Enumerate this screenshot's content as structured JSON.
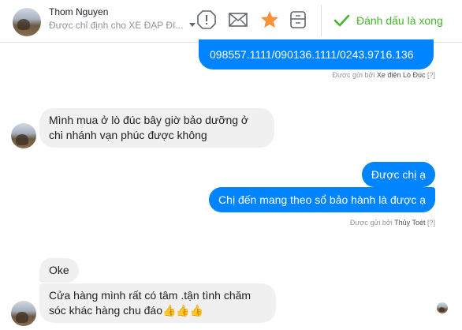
{
  "header": {
    "contact_name": "Thom Nguyen",
    "assignment": "Được chỉ định cho XE ĐẠP ĐI...",
    "done_label": "Đánh dấu là xong",
    "icons": [
      "spam-icon",
      "mail-icon",
      "star-icon",
      "archive-icon",
      "check-icon"
    ],
    "accent_star": "#f7923b",
    "accent_done": "#42b72a"
  },
  "messages": {
    "phone": "098557.1111/090136.1111/0243.9716.136",
    "sent_by_1_prefix": "Được gửi bởi",
    "sent_by_1_name": "Xe điện Lò Đúc",
    "help_marker": "[?]",
    "in_1": "Mình mua ở lò đúc bây giờ bảo dưỡng ở chi nhánh vạn phúc được không",
    "out_1": "Được chị ạ",
    "out_2": "Chị đến mang theo sổ bảo hành là được ạ",
    "sent_by_2_prefix": "Được gửi bởi",
    "sent_by_2_name": "Thủy Toét",
    "in_2": "Oke",
    "in_3": "Cửa hàng mình rất có tâm .tận tình chăm sóc khác hàng chu đáo",
    "in_3_emoji": "👍👍👍",
    "bubble_out_color": "#0084ff",
    "bubble_in_color": "#f1f0f0"
  }
}
